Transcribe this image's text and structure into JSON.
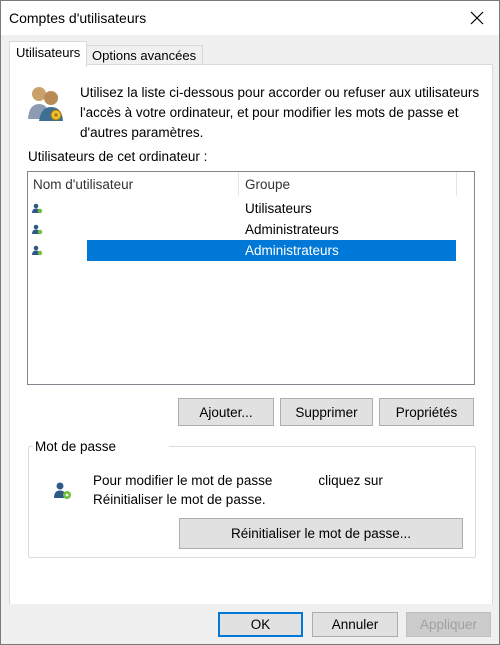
{
  "window": {
    "title": "Comptes d'utilisateurs"
  },
  "tabs": [
    {
      "label": "Utilisateurs",
      "active": true
    },
    {
      "label": "Options avancées",
      "active": false
    }
  ],
  "info": {
    "text": "Utilisez la liste ci-dessous pour accorder ou refuser aux utilisateurs l'accès à votre ordinateur, et pour modifier les mots de passe et d'autres paramètres."
  },
  "users_section": {
    "label": "Utilisateurs de cet ordinateur :",
    "columns": [
      "Nom d'utilisateur",
      "Groupe"
    ],
    "rows": [
      {
        "name": "",
        "group": "Utilisateurs",
        "selected": false
      },
      {
        "name": "",
        "group": "Administrateurs",
        "selected": false
      },
      {
        "name": "",
        "group": "Administrateurs",
        "selected": true
      }
    ]
  },
  "user_buttons": {
    "add": "Ajouter...",
    "remove": "Supprimer",
    "properties": "Propriétés"
  },
  "password_group": {
    "title": "Mot de passe",
    "text_line1": "Pour modifier le mot de passe",
    "text_line1b": "cliquez sur",
    "text_line2": "Réinitialiser le mot de passe.",
    "reset_button": "Réinitialiser le mot de passe..."
  },
  "footer": {
    "ok": "OK",
    "cancel": "Annuler",
    "apply": "Appliquer"
  },
  "colors": {
    "selection": "#0078d7",
    "window_bg": "#f0f0f0",
    "button_bg": "#e1e1e1"
  }
}
